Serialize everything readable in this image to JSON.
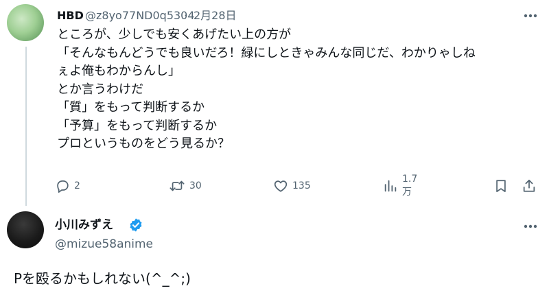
{
  "tweet": {
    "display_name": "HBD",
    "handle": "@z8yo77ND0q5304",
    "separator": "·",
    "date": "2月28日",
    "lines": [
      "ところが、少しでも安くあげたい上の方が",
      "「そんなもんどうでも良いだろ！緑にしときゃみんな同じだ、わかりゃしね",
      "ぇよ俺もわからんし」",
      "とか言うわけだ",
      "「質」をもって判断するか",
      "「予算」をもって判断するか",
      "プロというものをどう見るか？"
    ],
    "actions": {
      "reply_count": "2",
      "repost_count": "30",
      "like_count": "135",
      "view_count": "1.7万"
    }
  },
  "reply": {
    "display_name": "小川みずえ",
    "handle": "@mizue58anime",
    "text": "Pを殴るかもしれない(^_^;)"
  },
  "colors": {
    "text": "#0f1419",
    "secondary": "#536471",
    "verified": "#1d9bf0",
    "thread_line": "#cfd9de"
  },
  "icons": [
    "more-icon",
    "reply-icon",
    "repost-icon",
    "like-icon",
    "views-icon",
    "bookmark-icon",
    "share-icon",
    "verified-icon"
  ]
}
